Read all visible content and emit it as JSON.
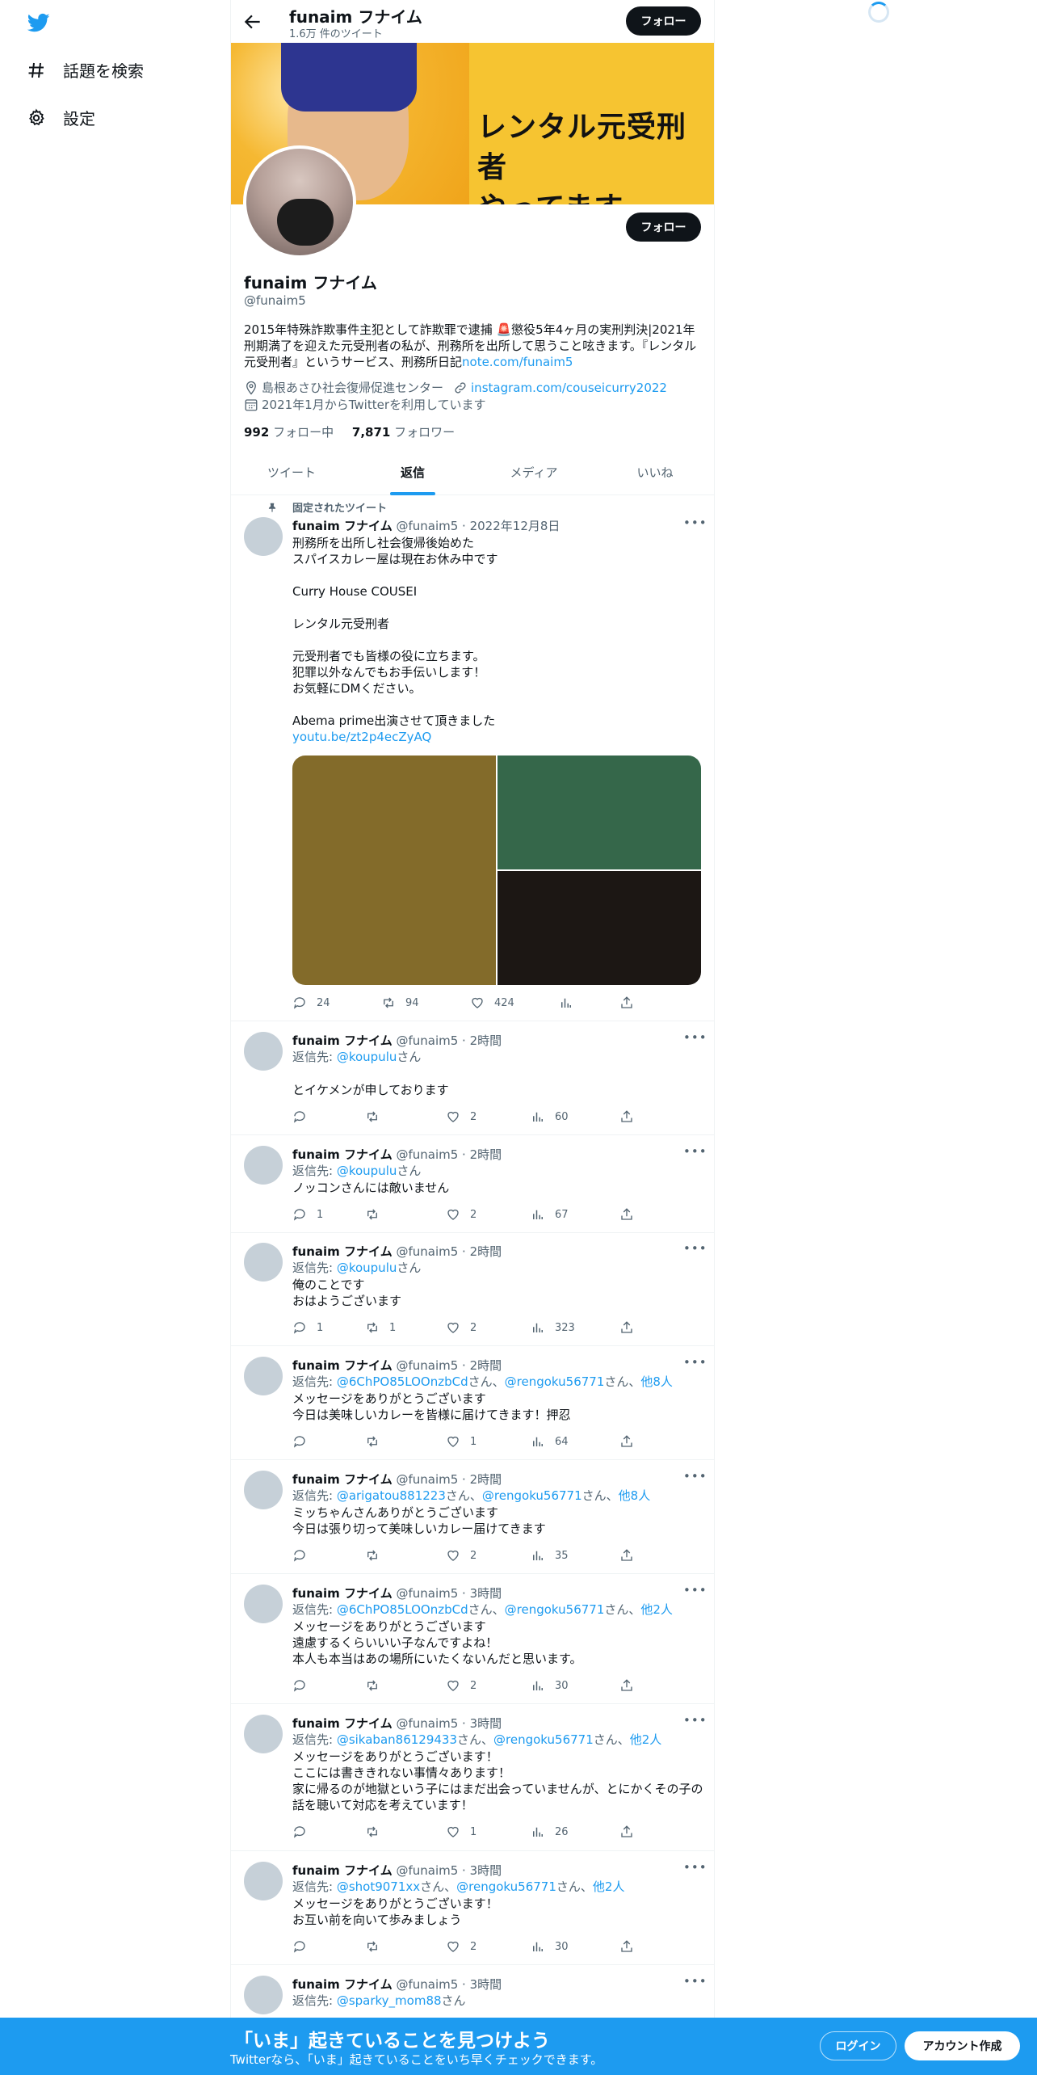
{
  "nav": {
    "explore_label": "話題を検索",
    "settings_label": "設定"
  },
  "topbar": {
    "title": "funaim フナイム",
    "tweet_count": "1.6万 件のツイート",
    "follow_label": "フォロー"
  },
  "banner": {
    "line1": "レンタル元受刑者",
    "line2": "やってます。"
  },
  "profile": {
    "follow_label": "フォロー",
    "name": "funaim フナイム",
    "handle": "@funaim5",
    "bio_text": "2015年特殊詐欺事件主犯として詐欺罪で逮捕 🚨懲役5年4ヶ月の実刑判決|2021年刑期満了を迎えた元受刑者の私が、刑務所を出所して思うこと呟きます。『レンタル元受刑者』というサービス、刑務所日記",
    "bio_link": "note.com/funaim5",
    "location": "島根あさひ社会復帰促進センター",
    "website": "instagram.com/couseicurry2022",
    "joined": "2021年1月からTwitterを利用しています",
    "following_count": "992",
    "following_label": "フォロー中",
    "followers_count": "7,871",
    "followers_label": "フォロワー"
  },
  "tabs": [
    "ツイート",
    "返信",
    "メディア",
    "いいね"
  ],
  "pinned_label": "固定されたツイート",
  "pinned": {
    "name": "funaim フナイム",
    "meta": "@funaim5 · 2022年12月8日",
    "text": "刑務所を出所し社会復帰後始めた\nスパイスカレー屋は現在お休み中です\n\nCurry House COUSEI\n\nレンタル元受刑者\n\n元受刑者でも皆様の役に立ちます。\n犯罪以外なんでもお手伝いします！\nお気軽にDMください。\n\nAbema prime出演させて頂きました",
    "link": "youtu.be/zt2p4ecZyAQ",
    "replies": "24",
    "retweets": "94",
    "likes": "424"
  },
  "tweets": [
    {
      "name": "funaim フナイム",
      "meta": "@funaim5 · 2時間",
      "reply_prefix": "返信先: ",
      "reply_to": "@koupulu",
      "reply_suffix": "さん",
      "text": "\nとイケメンが申しております",
      "replies": "",
      "retweets": "",
      "likes": "2",
      "views": "60"
    },
    {
      "name": "funaim フナイム",
      "meta": "@funaim5 · 2時間",
      "reply_prefix": "返信先: ",
      "reply_to": "@koupulu",
      "reply_suffix": "さん",
      "text": "ノッコンさんには敵いません",
      "replies": "1",
      "retweets": "",
      "likes": "2",
      "views": "67"
    },
    {
      "name": "funaim フナイム",
      "meta": "@funaim5 · 2時間",
      "reply_prefix": "返信先: ",
      "reply_to": "@koupulu",
      "reply_suffix": "さん",
      "text": "俺のことです\nおはようございます",
      "replies": "1",
      "retweets": "1",
      "likes": "2",
      "views": "323"
    },
    {
      "name": "funaim フナイム",
      "meta": "@funaim5 · 2時間",
      "reply_prefix": "返信先: ",
      "reply_to": "@6ChPO85LOOnzbCd",
      "reply_suffix": "さん、",
      "reply_to2": "@rengoku56771",
      "reply_suffix2": "さん、",
      "reply_others": "他8人",
      "text": "メッセージをありがとうございます\n今日は美味しいカレーを皆様に届けてきます！押忍",
      "replies": "",
      "retweets": "",
      "likes": "1",
      "views": "64"
    },
    {
      "name": "funaim フナイム",
      "meta": "@funaim5 · 2時間",
      "reply_prefix": "返信先: ",
      "reply_to": "@arigatou881223",
      "reply_suffix": "さん、",
      "reply_to2": "@rengoku56771",
      "reply_suffix2": "さん、",
      "reply_others": "他8人",
      "text": "ミッちゃんさんありがとうございます\n今日は張り切って美味しいカレー届けてきます",
      "replies": "",
      "retweets": "",
      "likes": "2",
      "views": "35"
    },
    {
      "name": "funaim フナイム",
      "meta": "@funaim5 · 3時間",
      "reply_prefix": "返信先: ",
      "reply_to": "@6ChPO85LOOnzbCd",
      "reply_suffix": "さん、",
      "reply_to2": "@rengoku56771",
      "reply_suffix2": "さん、",
      "reply_others": "他2人",
      "text": "メッセージをありがとうございます\n遠慮するくらいいい子なんですよね！\n本人も本当はあの場所にいたくないんだと思います。",
      "replies": "",
      "retweets": "",
      "likes": "2",
      "views": "30"
    },
    {
      "name": "funaim フナイム",
      "meta": "@funaim5 · 3時間",
      "reply_prefix": "返信先: ",
      "reply_to": "@sikaban86129433",
      "reply_suffix": "さん、",
      "reply_to2": "@rengoku56771",
      "reply_suffix2": "さん、",
      "reply_others": "他2人",
      "text": "メッセージをありがとうございます！\nここには書ききれない事情々あります！\n家に帰るのが地獄という子にはまだ出会っていませんが、とにかくその子の話を聴いて対応を考えています！",
      "replies": "",
      "retweets": "",
      "likes": "1",
      "views": "26"
    },
    {
      "name": "funaim フナイム",
      "meta": "@funaim5 · 3時間",
      "reply_prefix": "返信先: ",
      "reply_to": "@shot9071xx",
      "reply_suffix": "さん、",
      "reply_to2": "@rengoku56771",
      "reply_suffix2": "さん、",
      "reply_others": "他2人",
      "text": "メッセージをありがとうございます！\nお互い前を向いて歩みましょう",
      "replies": "",
      "retweets": "",
      "likes": "2",
      "views": "30"
    },
    {
      "name": "funaim フナイム",
      "meta": "@funaim5 · 3時間",
      "reply_prefix": "返信先: ",
      "reply_to": "@sparky_mom88",
      "reply_suffix": "さん",
      "text": "",
      "replies": "",
      "retweets": "",
      "likes": "",
      "views": ""
    }
  ],
  "bottom_bar": {
    "title": "「いま」起きていることを見つけよう",
    "subtitle": "Twitterなら、「いま」起きていることをいち早くチェックできます。",
    "login_label": "ログイン",
    "signup_label": "アカウント作成"
  }
}
